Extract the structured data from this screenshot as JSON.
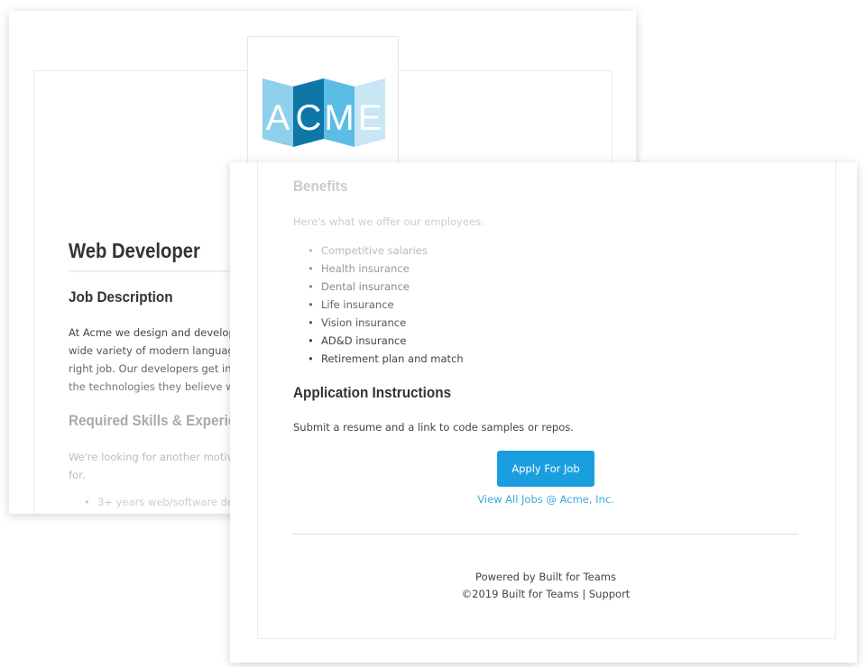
{
  "logo": {
    "text": "ACME",
    "colors": [
      "#8fd0ec",
      "#0e77a8",
      "#5bbde6",
      "#c8e6f4"
    ]
  },
  "job": {
    "title": "Web Developer",
    "description_heading": "Job Description",
    "description_lines": [
      "At Acme we design and develop",
      "wide variety of modern language",
      "right job. Our developers get inc",
      "the technologies they believe wil"
    ],
    "skills_heading": "Required Skills & Experien",
    "skills_intro_lines": [
      "We're looking for another motiva",
      "for."
    ],
    "skills_items": [
      "3+ years web/software dev"
    ]
  },
  "benefits": {
    "heading": "Benefits",
    "intro": "Here's what we offer our employees:",
    "items": [
      "Competitive salaries",
      "Health insurance",
      "Dental insurance",
      "Life insurance",
      "Vision insurance",
      "AD&D insurance",
      "Retirement plan and match"
    ]
  },
  "application": {
    "heading": "Application Instructions",
    "text": "Submit a resume and a link to code samples or repos.",
    "apply_label": "Apply For Job",
    "view_all_label": "View All Jobs @ Acme, Inc."
  },
  "footer": {
    "powered": "Powered by Built for Teams",
    "copyright": "©2019 Built for Teams",
    "separator": "|",
    "support": "Support"
  },
  "colors": {
    "accent": "#1a9ee0",
    "link": "#3aa9e0"
  }
}
